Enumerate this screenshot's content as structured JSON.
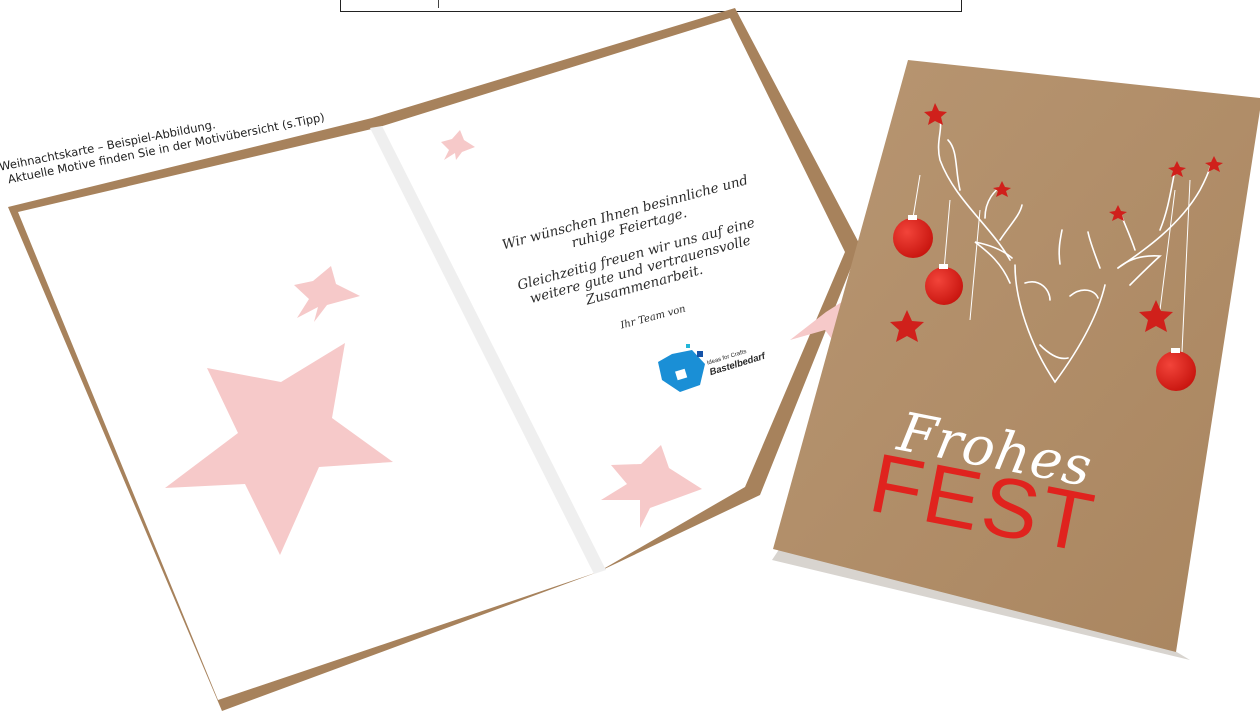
{
  "caption": {
    "line1": "Weihnachtskarte – Beispiel-Abbildung.",
    "line2": "Aktuelle Motive finden Sie in der Motivübersicht (s.Tipp)"
  },
  "inside": {
    "greeting1": "Wir wünschen Ihnen besinnliche und ruhige Feiertage.",
    "greeting2": "Gleichzeitig freuen wir uns auf eine weitere gute und vertrauensvolle Zusammenarbeit.",
    "signature": "Ihr Team von"
  },
  "logo": {
    "tagline": "Ideas for Crafts",
    "name": "Bastelbedarf"
  },
  "cover": {
    "script_word": "Frohes",
    "main_word": "FEST"
  },
  "colors": {
    "kraft": "#b08d68",
    "star_pink": "#f6c9c9",
    "ornament_red": "#e0231e",
    "logo_blue": "#1a8fd6"
  }
}
